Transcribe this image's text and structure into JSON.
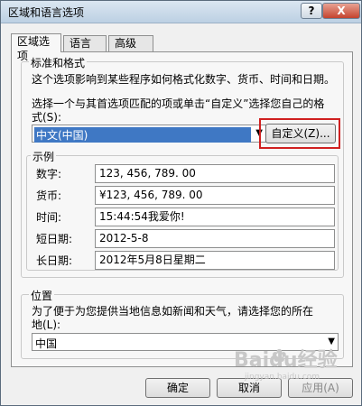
{
  "window": {
    "title": "区域和语言选项"
  },
  "titlebar_buttons": {
    "help": "?",
    "close": "X"
  },
  "tabs": [
    {
      "label": "区域选项",
      "active": true
    },
    {
      "label": "语言",
      "active": false
    },
    {
      "label": "高级",
      "active": false
    }
  ],
  "standards": {
    "legend": "标准和格式",
    "description": "这个选项影响到某些程序如何格式化数字、货币、时间和日期。",
    "instruction_line1": "选择一个与其首选项匹配的项或单击“自定义”选择您自己的格",
    "instruction_line2": "式(S):",
    "selected_locale": "中文(中国)",
    "customize_button": "自定义(Z)..."
  },
  "examples": {
    "legend": "示例",
    "rows": [
      {
        "label": "数字:",
        "value": "123, 456, 789. 00"
      },
      {
        "label": "货币:",
        "value": "¥123, 456, 789. 00"
      },
      {
        "label": "时间:",
        "value": "15:44:54我爱你!"
      },
      {
        "label": "短日期:",
        "value": "2012-5-8"
      },
      {
        "label": "长日期:",
        "value": "2012年5月8日星期二"
      }
    ]
  },
  "location": {
    "legend": "位置",
    "description_line1": "为了便于为您提供当地信息如新闻和天气，请选择您的所在",
    "description_line2": "地(L):",
    "selected": "中国"
  },
  "footer": {
    "ok": "确定",
    "cancel": "取消",
    "apply": "应用(A)"
  },
  "watermark": {
    "text": "Baidu经验",
    "url": "jingyan.baidu.com"
  }
}
